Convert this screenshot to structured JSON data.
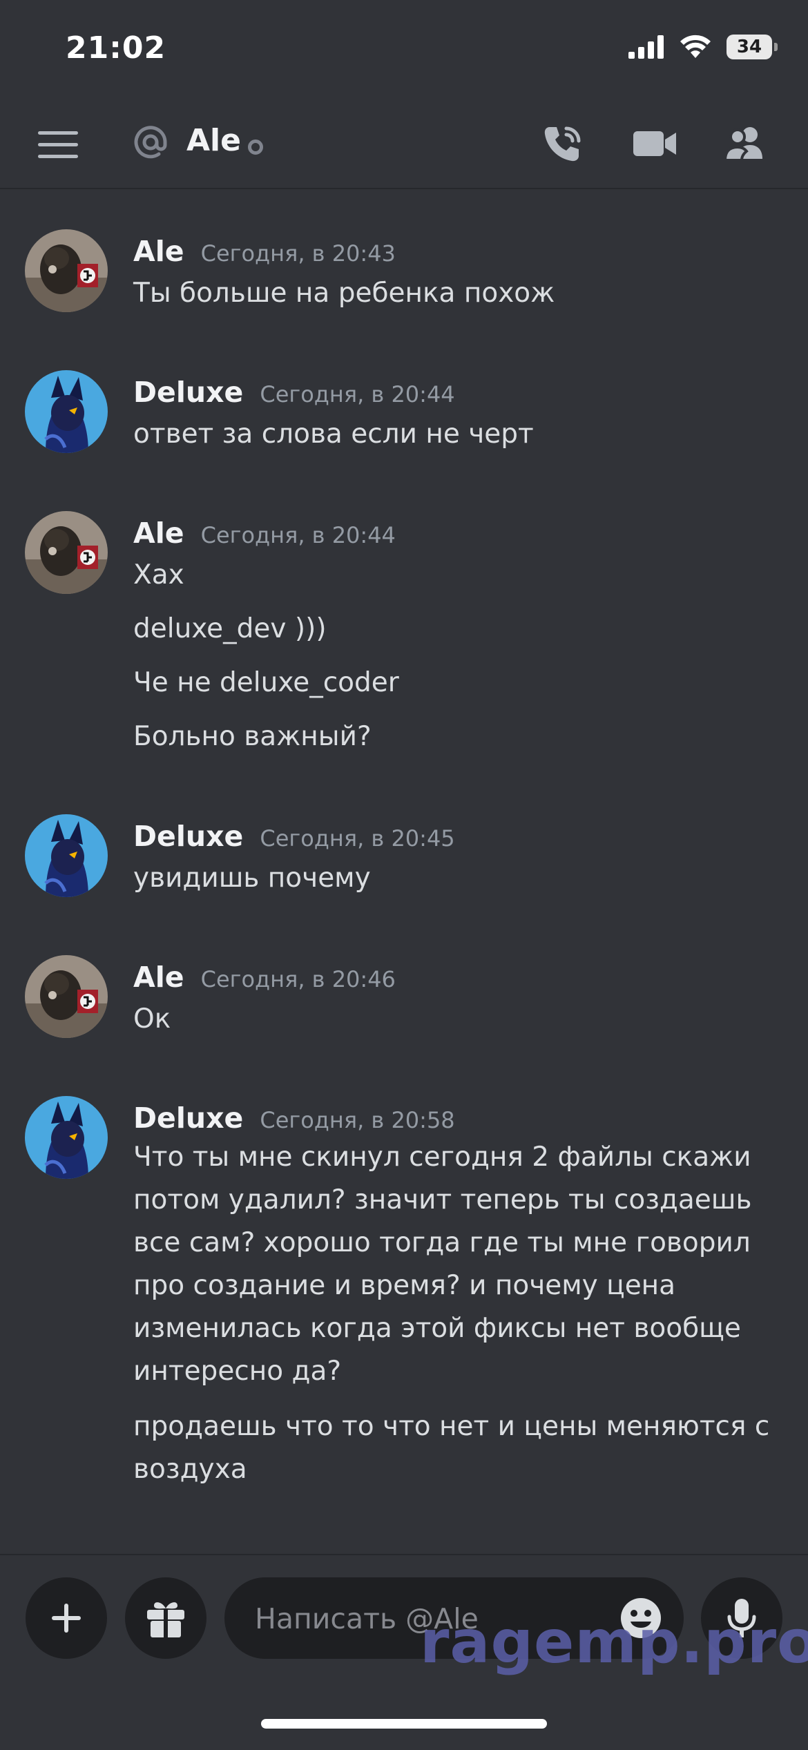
{
  "status": {
    "time": "21:02",
    "battery": "34"
  },
  "header": {
    "channel_name": "Ale"
  },
  "messages": [
    {
      "author": "Ale",
      "time": "Сегодня, в 20:43",
      "lines": [
        "Ты больше на ребенка похож"
      ]
    },
    {
      "author": "Deluxe",
      "time": "Сегодня, в 20:44",
      "lines": [
        "ответ за слова если не черт"
      ]
    },
    {
      "author": "Ale",
      "time": "Сегодня, в 20:44",
      "lines": [
        "Хах",
        "deluxe_dev )))",
        "Че не deluxe_coder",
        "Больно важный?"
      ]
    },
    {
      "author": "Deluxe",
      "time": "Сегодня, в 20:45",
      "lines": [
        "увидишь почему"
      ]
    },
    {
      "author": "Ale",
      "time": "Сегодня, в 20:46",
      "lines": [
        "Ок"
      ]
    },
    {
      "author": "Deluxe",
      "time": "Сегодня, в 20:58",
      "lines": [
        "Что ты мне скинул сегодня 2 файлы скажи",
        "потом удалил? значит теперь ты создаешь",
        "все сам? хорошо тогда где ты мне говорил",
        "про создание и время? и почему цена",
        "изменилась когда этой фиксы нет вообще",
        "интересно да?",
        "продаешь что то что нет и цены меняются с",
        "воздуха"
      ]
    }
  ],
  "composer": {
    "placeholder": "Написать @Ale"
  },
  "watermark": "ragemp.pro",
  "icons": {
    "menu": "hamburger-icon",
    "mention": "at-icon",
    "call": "phone-call-icon",
    "video": "video-camera-icon",
    "members": "members-icon",
    "add": "plus-icon",
    "gift": "gift-icon",
    "emoji": "emoji-icon",
    "mic": "microphone-icon"
  },
  "colors": {
    "background": "#313338",
    "input": "#1e1f22",
    "muted": "#949ba4",
    "text": "#dbdee1"
  }
}
